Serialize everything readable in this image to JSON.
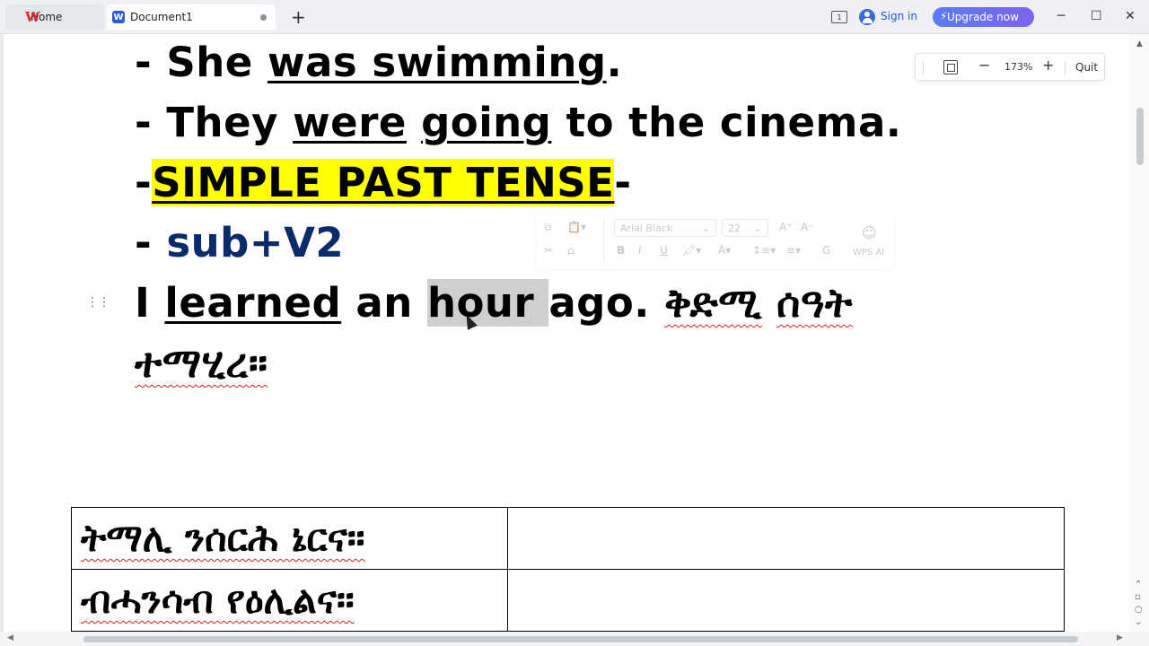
{
  "tabs": {
    "home_label": "Home",
    "doc_label": "Document1"
  },
  "titlebar": {
    "layout_icon_label": "1",
    "signin": "Sign in",
    "upgrade": "Upgrade now"
  },
  "zoom": {
    "level": "173%",
    "quit": "Quit"
  },
  "mini_toolbar": {
    "font": "Arial Black",
    "size": "22",
    "ai_label": "WPS AI"
  },
  "document": {
    "line1": {
      "dash": "- ",
      "pre": "She ",
      "verb": "was swimming",
      "post": "."
    },
    "line2": {
      "dash": "- ",
      "pre": "They ",
      "verb1": "were",
      "space": " ",
      "verb2": "going",
      "post": " to the cinema."
    },
    "line3": {
      "dash_left": "-",
      "heading": "SIMPLE PAST TENSE",
      "dash_right": "-"
    },
    "line4": {
      "dash": "- ",
      "formula": "sub+V2"
    },
    "line5": {
      "pre": "I ",
      "verb": "learned",
      "mid": " an ",
      "selected": "hour ",
      "post": "ago. ",
      "tig1": "ቅድሚ",
      "space": " ",
      "tig2": "ሰዓት"
    },
    "line6": {
      "tig3": "ተማሂረ።"
    }
  },
  "table": {
    "rows": [
      {
        "col1": "ትማሊ ንሰርሕ ኔርና።",
        "col2": ""
      },
      {
        "col1": "ብሓንሳብ የዕሊልና።",
        "col2": ""
      }
    ]
  },
  "colors": {
    "highlight": "#ffff00",
    "formula_blue": "#0b2a6b",
    "upgrade_button": "#5a7cf5",
    "spell_error": "#e02020"
  }
}
